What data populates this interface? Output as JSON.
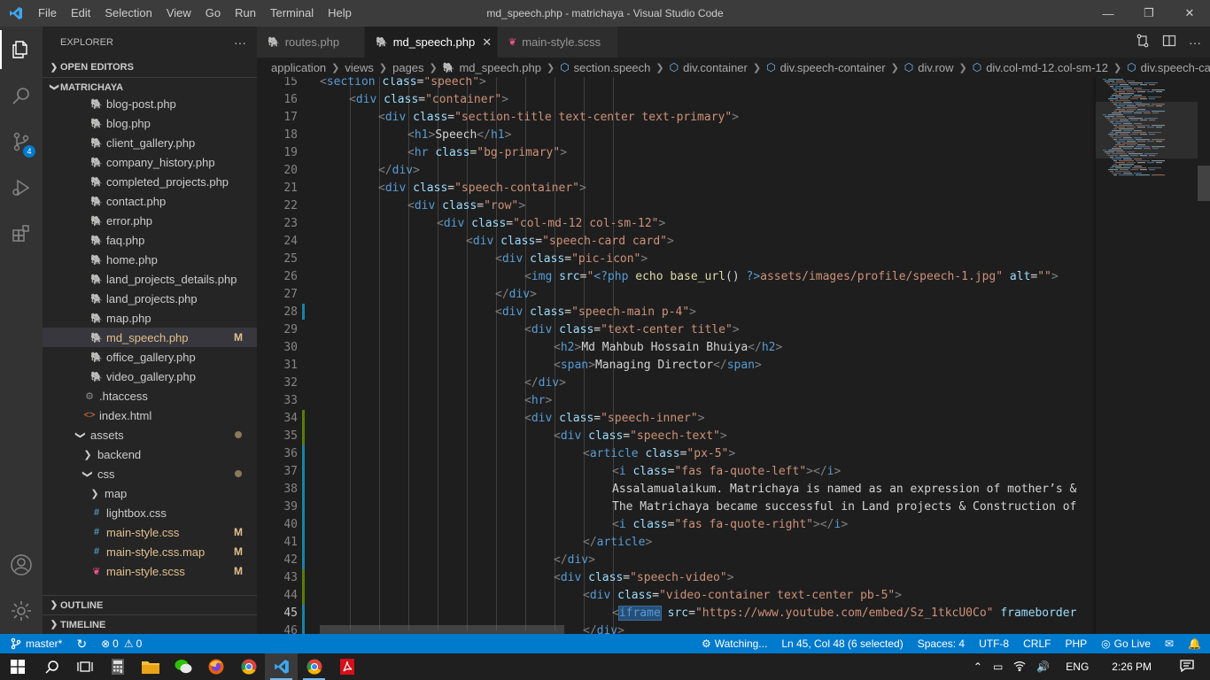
{
  "window": {
    "title": "md_speech.php - matrichaya - Visual Studio Code",
    "menu": [
      "File",
      "Edit",
      "Selection",
      "View",
      "Go",
      "Run",
      "Terminal",
      "Help"
    ]
  },
  "activity": {
    "source_control_badge": "4"
  },
  "sidebar": {
    "header": "EXPLORER",
    "header_more": "···",
    "open_editors": "OPEN EDITORS",
    "project": "MATRICHAYA",
    "items": [
      {
        "name": "blog-post.php",
        "type": "php",
        "indent": 1
      },
      {
        "name": "blog.php",
        "type": "php",
        "indent": 1
      },
      {
        "name": "client_gallery.php",
        "type": "php",
        "indent": 1
      },
      {
        "name": "company_history.php",
        "type": "php",
        "indent": 1
      },
      {
        "name": "completed_projects.php",
        "type": "php",
        "indent": 1
      },
      {
        "name": "contact.php",
        "type": "php",
        "indent": 1
      },
      {
        "name": "error.php",
        "type": "php",
        "indent": 1
      },
      {
        "name": "faq.php",
        "type": "php",
        "indent": 1
      },
      {
        "name": "home.php",
        "type": "php",
        "indent": 1
      },
      {
        "name": "land_projects_details.php",
        "type": "php",
        "indent": 1
      },
      {
        "name": "land_projects.php",
        "type": "php",
        "indent": 1
      },
      {
        "name": "map.php",
        "type": "php",
        "indent": 1
      },
      {
        "name": "md_speech.php",
        "type": "php",
        "indent": 1,
        "status": "M",
        "selected": true
      },
      {
        "name": "office_gallery.php",
        "type": "php",
        "indent": 1
      },
      {
        "name": "video_gallery.php",
        "type": "php",
        "indent": 1
      },
      {
        "name": ".htaccess",
        "type": "gear",
        "indent": 0
      },
      {
        "name": "index.html",
        "type": "html",
        "indent": 0
      },
      {
        "name": "assets",
        "type": "folder-open",
        "indent": -1,
        "dot": true
      },
      {
        "name": "backend",
        "type": "folder",
        "indent": 0
      },
      {
        "name": "css",
        "type": "folder-open",
        "indent": 0,
        "dot": true
      },
      {
        "name": "map",
        "type": "folder",
        "indent": 1
      },
      {
        "name": "lightbox.css",
        "type": "css",
        "indent": 1
      },
      {
        "name": "main-style.css",
        "type": "css",
        "indent": 1,
        "status": "M"
      },
      {
        "name": "main-style.css.map",
        "type": "css",
        "indent": 1,
        "status": "M"
      },
      {
        "name": "main-style.scss",
        "type": "scss",
        "indent": 1,
        "status": "M"
      }
    ],
    "outline": "OUTLINE",
    "timeline": "TIMELINE"
  },
  "tabs": [
    {
      "label": "routes.php",
      "icon": "php",
      "active": false
    },
    {
      "label": "md_speech.php",
      "icon": "php",
      "active": true
    },
    {
      "label": "main-style.scss",
      "icon": "scss",
      "active": false
    }
  ],
  "breadcrumb": [
    "application",
    "views",
    "pages",
    "md_speech.php",
    "section.speech",
    "div.container",
    "div.speech-container",
    "div.row",
    "div.col-md-12.col-sm-12",
    "div.speech-card"
  ],
  "editor": {
    "line_numbers": [
      "15",
      "16",
      "17",
      "18",
      "19",
      "20",
      "21",
      "22",
      "23",
      "24",
      "25",
      "26",
      "27",
      "28",
      "29",
      "30",
      "31",
      "32",
      "33",
      "34",
      "35",
      "36",
      "37",
      "38",
      "39",
      "40",
      "41",
      "42",
      "43",
      "44",
      "45",
      "46"
    ],
    "current_line": "45",
    "lines": [
      {
        "indent": 0,
        "tokens": [
          [
            "br",
            "<"
          ],
          [
            "tg",
            "section"
          ],
          [
            "tx",
            " "
          ],
          [
            "at",
            "class"
          ],
          [
            "tx",
            "="
          ],
          [
            "st",
            "\"speech\""
          ],
          [
            "br",
            ">"
          ]
        ]
      },
      {
        "indent": 1,
        "tokens": [
          [
            "br",
            "<"
          ],
          [
            "tg",
            "div"
          ],
          [
            "tx",
            " "
          ],
          [
            "at",
            "class"
          ],
          [
            "tx",
            "="
          ],
          [
            "st",
            "\"container\""
          ],
          [
            "br",
            ">"
          ]
        ]
      },
      {
        "indent": 2,
        "tokens": [
          [
            "br",
            "<"
          ],
          [
            "tg",
            "div"
          ],
          [
            "tx",
            " "
          ],
          [
            "at",
            "class"
          ],
          [
            "tx",
            "="
          ],
          [
            "st",
            "\"section-title text-center text-primary\""
          ],
          [
            "br",
            ">"
          ]
        ]
      },
      {
        "indent": 3,
        "tokens": [
          [
            "br",
            "<"
          ],
          [
            "tg",
            "h1"
          ],
          [
            "br",
            ">"
          ],
          [
            "tx",
            "Speech"
          ],
          [
            "br",
            "</"
          ],
          [
            "tg",
            "h1"
          ],
          [
            "br",
            ">"
          ]
        ]
      },
      {
        "indent": 3,
        "tokens": [
          [
            "br",
            "<"
          ],
          [
            "tg",
            "hr"
          ],
          [
            "tx",
            " "
          ],
          [
            "at",
            "class"
          ],
          [
            "tx",
            "="
          ],
          [
            "st",
            "\"bg-primary\""
          ],
          [
            "br",
            ">"
          ]
        ]
      },
      {
        "indent": 2,
        "tokens": [
          [
            "br",
            "</"
          ],
          [
            "tg",
            "div"
          ],
          [
            "br",
            ">"
          ]
        ]
      },
      {
        "indent": 2,
        "tokens": [
          [
            "br",
            "<"
          ],
          [
            "tg",
            "div"
          ],
          [
            "tx",
            " "
          ],
          [
            "at",
            "class"
          ],
          [
            "tx",
            "="
          ],
          [
            "st",
            "\"speech-container\""
          ],
          [
            "br",
            ">"
          ]
        ]
      },
      {
        "indent": 3,
        "tokens": [
          [
            "br",
            "<"
          ],
          [
            "tg",
            "div"
          ],
          [
            "tx",
            " "
          ],
          [
            "at",
            "class"
          ],
          [
            "tx",
            "="
          ],
          [
            "st",
            "\"row\""
          ],
          [
            "br",
            ">"
          ]
        ]
      },
      {
        "indent": 4,
        "tokens": [
          [
            "br",
            "<"
          ],
          [
            "tg",
            "div"
          ],
          [
            "tx",
            " "
          ],
          [
            "at",
            "class"
          ],
          [
            "tx",
            "="
          ],
          [
            "st",
            "\"col-md-12 col-sm-12\""
          ],
          [
            "br",
            ">"
          ]
        ]
      },
      {
        "indent": 5,
        "tokens": [
          [
            "br",
            "<"
          ],
          [
            "tg",
            "div"
          ],
          [
            "tx",
            " "
          ],
          [
            "at",
            "class"
          ],
          [
            "tx",
            "="
          ],
          [
            "st",
            "\"speech-card card\""
          ],
          [
            "br",
            ">"
          ]
        ]
      },
      {
        "indent": 6,
        "tokens": [
          [
            "br",
            "<"
          ],
          [
            "tg",
            "div"
          ],
          [
            "tx",
            " "
          ],
          [
            "at",
            "class"
          ],
          [
            "tx",
            "="
          ],
          [
            "st",
            "\"pic-icon\""
          ],
          [
            "br",
            ">"
          ]
        ]
      },
      {
        "indent": 7,
        "tokens": [
          [
            "br",
            "<"
          ],
          [
            "tg",
            "img"
          ],
          [
            "tx",
            " "
          ],
          [
            "at",
            "src"
          ],
          [
            "tx",
            "="
          ],
          [
            "st",
            "\""
          ],
          [
            "ph",
            "<?php"
          ],
          [
            "tx",
            " "
          ],
          [
            "fn",
            "echo"
          ],
          [
            "tx",
            " "
          ],
          [
            "fn",
            "base_url"
          ],
          [
            "tx",
            "() "
          ],
          [
            "ph",
            "?>"
          ],
          [
            "st",
            "assets/images/profile/speech-1.jpg\""
          ],
          [
            "tx",
            " "
          ],
          [
            "at",
            "alt"
          ],
          [
            "tx",
            "="
          ],
          [
            "st",
            "\"\""
          ],
          [
            "br",
            ">"
          ]
        ]
      },
      {
        "indent": 6,
        "tokens": [
          [
            "br",
            "</"
          ],
          [
            "tg",
            "div"
          ],
          [
            "br",
            ">"
          ]
        ]
      },
      {
        "indent": 6,
        "tokens": [
          [
            "br",
            "<"
          ],
          [
            "tg",
            "div"
          ],
          [
            "tx",
            " "
          ],
          [
            "at",
            "class"
          ],
          [
            "tx",
            "="
          ],
          [
            "st",
            "\"speech-main p-4\""
          ],
          [
            "br",
            ">"
          ]
        ]
      },
      {
        "indent": 7,
        "tokens": [
          [
            "br",
            "<"
          ],
          [
            "tg",
            "div"
          ],
          [
            "tx",
            " "
          ],
          [
            "at",
            "class"
          ],
          [
            "tx",
            "="
          ],
          [
            "st",
            "\"text-center title\""
          ],
          [
            "br",
            ">"
          ]
        ]
      },
      {
        "indent": 8,
        "tokens": [
          [
            "br",
            "<"
          ],
          [
            "tg",
            "h2"
          ],
          [
            "br",
            ">"
          ],
          [
            "tx",
            "Md Mahbub Hossain Bhuiya"
          ],
          [
            "br",
            "</"
          ],
          [
            "tg",
            "h2"
          ],
          [
            "br",
            ">"
          ]
        ]
      },
      {
        "indent": 8,
        "tokens": [
          [
            "br",
            "<"
          ],
          [
            "tg",
            "span"
          ],
          [
            "br",
            ">"
          ],
          [
            "tx",
            "Managing Director"
          ],
          [
            "br",
            "</"
          ],
          [
            "tg",
            "span"
          ],
          [
            "br",
            ">"
          ]
        ]
      },
      {
        "indent": 7,
        "tokens": [
          [
            "br",
            "</"
          ],
          [
            "tg",
            "div"
          ],
          [
            "br",
            ">"
          ]
        ]
      },
      {
        "indent": 7,
        "tokens": [
          [
            "br",
            "<"
          ],
          [
            "tg",
            "hr"
          ],
          [
            "br",
            ">"
          ]
        ]
      },
      {
        "indent": 7,
        "tokens": [
          [
            "br",
            "<"
          ],
          [
            "tg",
            "div"
          ],
          [
            "tx",
            " "
          ],
          [
            "at",
            "class"
          ],
          [
            "tx",
            "="
          ],
          [
            "st",
            "\"speech-inner\""
          ],
          [
            "br",
            ">"
          ]
        ]
      },
      {
        "indent": 8,
        "tokens": [
          [
            "br",
            "<"
          ],
          [
            "tg",
            "div"
          ],
          [
            "tx",
            " "
          ],
          [
            "at",
            "class"
          ],
          [
            "tx",
            "="
          ],
          [
            "st",
            "\"speech-text\""
          ],
          [
            "br",
            ">"
          ]
        ]
      },
      {
        "indent": 9,
        "tokens": [
          [
            "br",
            "<"
          ],
          [
            "tg",
            "article"
          ],
          [
            "tx",
            " "
          ],
          [
            "at",
            "class"
          ],
          [
            "tx",
            "="
          ],
          [
            "st",
            "\"px-5\""
          ],
          [
            "br",
            ">"
          ]
        ]
      },
      {
        "indent": 10,
        "tokens": [
          [
            "br",
            "<"
          ],
          [
            "tg",
            "i"
          ],
          [
            "tx",
            " "
          ],
          [
            "at",
            "class"
          ],
          [
            "tx",
            "="
          ],
          [
            "st",
            "\"fas fa-quote-left\""
          ],
          [
            "br",
            "></"
          ],
          [
            "tg",
            "i"
          ],
          [
            "br",
            ">"
          ]
        ]
      },
      {
        "indent": 10,
        "tokens": [
          [
            "tx",
            "Assalamualaikum. Matrichaya is named as an expression of mother’s &"
          ]
        ]
      },
      {
        "indent": 10,
        "tokens": [
          [
            "tx",
            "The Matrichaya became successful in Land projects & Construction of"
          ]
        ]
      },
      {
        "indent": 10,
        "tokens": [
          [
            "br",
            "<"
          ],
          [
            "tg",
            "i"
          ],
          [
            "tx",
            " "
          ],
          [
            "at",
            "class"
          ],
          [
            "tx",
            "="
          ],
          [
            "st",
            "\"fas fa-quote-right\""
          ],
          [
            "br",
            "></"
          ],
          [
            "tg",
            "i"
          ],
          [
            "br",
            ">"
          ]
        ]
      },
      {
        "indent": 9,
        "tokens": [
          [
            "br",
            "</"
          ],
          [
            "tg",
            "article"
          ],
          [
            "br",
            ">"
          ]
        ]
      },
      {
        "indent": 8,
        "tokens": [
          [
            "br",
            "</"
          ],
          [
            "tg",
            "div"
          ],
          [
            "br",
            ">"
          ]
        ]
      },
      {
        "indent": 8,
        "tokens": [
          [
            "br",
            "<"
          ],
          [
            "tg",
            "div"
          ],
          [
            "tx",
            " "
          ],
          [
            "at",
            "class"
          ],
          [
            "tx",
            "="
          ],
          [
            "st",
            "\"speech-video\""
          ],
          [
            "br",
            ">"
          ]
        ]
      },
      {
        "indent": 9,
        "tokens": [
          [
            "br",
            "<"
          ],
          [
            "tg",
            "div"
          ],
          [
            "tx",
            " "
          ],
          [
            "at",
            "class"
          ],
          [
            "tx",
            "="
          ],
          [
            "st",
            "\"video-container text-center pb-5\""
          ],
          [
            "br",
            ">"
          ]
        ]
      },
      {
        "indent": 10,
        "tokens": [
          [
            "br",
            "<"
          ],
          [
            "sel",
            "iframe"
          ],
          [
            "tx",
            " "
          ],
          [
            "at",
            "src"
          ],
          [
            "tx",
            "="
          ],
          [
            "st",
            "\"https://www.youtube.com/embed/Sz_1tkcU0Co\""
          ],
          [
            "tx",
            " "
          ],
          [
            "at",
            "frameborder"
          ]
        ]
      },
      {
        "indent": 9,
        "tokens": [
          [
            "br",
            "</"
          ],
          [
            "tg",
            "div"
          ],
          [
            "br",
            ">"
          ]
        ]
      }
    ]
  },
  "statusbar": {
    "branch": "master*",
    "problems": "0",
    "warnings": "0",
    "watching": "Watching...",
    "position": "Ln 45, Col 48 (6 selected)",
    "spaces": "Spaces: 4",
    "encoding": "UTF-8",
    "eol": "CRLF",
    "language": "PHP",
    "golive": "Go Live"
  },
  "taskbar": {
    "lang": "ENG",
    "time": "2:26 PM"
  },
  "colors": {
    "accent": "#007acc",
    "modified": "#e2c08d"
  }
}
